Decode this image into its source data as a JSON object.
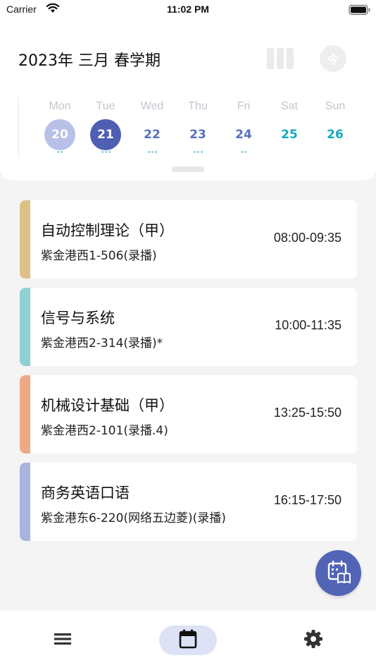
{
  "status_bar": {
    "carrier": "Carrier",
    "time": "11:02 PM"
  },
  "header": {
    "title": "2023年 三月 春学期",
    "today_button": "今"
  },
  "week": {
    "days": [
      {
        "name": "Mon",
        "date": "20",
        "state": "past",
        "dots": 2
      },
      {
        "name": "Tue",
        "date": "21",
        "state": "today",
        "dots": 3
      },
      {
        "name": "Wed",
        "date": "22",
        "state": "normal",
        "dots": 3
      },
      {
        "name": "Thu",
        "date": "23",
        "state": "normal",
        "dots": 3
      },
      {
        "name": "Fri",
        "date": "24",
        "state": "normal",
        "dots": 2
      },
      {
        "name": "Sat",
        "date": "25",
        "state": "weekend",
        "dots": 0
      },
      {
        "name": "Sun",
        "date": "26",
        "state": "weekend",
        "dots": 0
      }
    ]
  },
  "courses": [
    {
      "name": "自动控制理论（甲）",
      "room": "紫金港西1-506(录播)",
      "time": "08:00-09:35",
      "color": "#ddc186"
    },
    {
      "name": "信号与系统",
      "room": "紫金港西2-314(录播)*",
      "time": "10:00-11:35",
      "color": "#8ed0d4"
    },
    {
      "name": "机械设计基础（甲）",
      "room": "紫金港西2-101(录播.4)",
      "time": "13:25-15:50",
      "color": "#eda985"
    },
    {
      "name": "商务英语口语",
      "room": "紫金港东6-220(网络五边菱)(录播)",
      "time": "16:15-17:50",
      "color": "#a9b4de"
    }
  ],
  "colors": {
    "accent": "#4f5fb2",
    "weekend": "#13a9bb",
    "fab": "#5164b5"
  },
  "tabs": [
    {
      "icon": "list-icon",
      "active": false
    },
    {
      "icon": "calendar-icon",
      "active": true
    },
    {
      "icon": "gear-icon",
      "active": false
    }
  ]
}
